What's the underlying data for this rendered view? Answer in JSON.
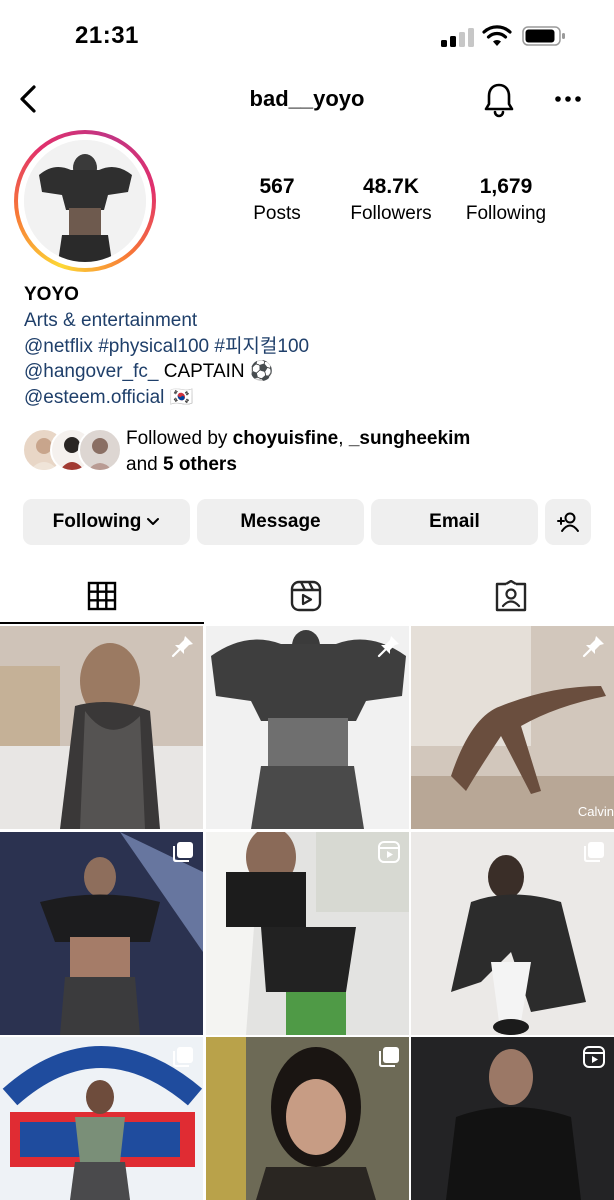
{
  "status_bar": {
    "time": "21:31"
  },
  "header": {
    "username": "bad__yoyo"
  },
  "stats": [
    {
      "num": "567",
      "label": "Posts"
    },
    {
      "num": "48.7K",
      "label": "Followers"
    },
    {
      "num": "1,679",
      "label": "Following"
    }
  ],
  "bio": {
    "name": "YOYO",
    "category": "Arts & entertainment",
    "line1": "@netflix #physical100 #피지컬100",
    "line2_link": "@hangover_fc_",
    "line2_text": " CAPTAIN ⚽",
    "line3_link": "@esteem.official",
    "line3_flag": " 🇰🇷"
  },
  "followed_by": {
    "prefix": "Followed by ",
    "user1": "choyuisfine",
    "sep": ", ",
    "user2": "_sungheekim",
    "and": "and ",
    "others": "5 others"
  },
  "buttons": {
    "following": "Following",
    "message": "Message",
    "email": "Email"
  },
  "tabs": [
    "grid",
    "reels",
    "tagged"
  ],
  "grid_posts": [
    {
      "badge": "pin",
      "bg": "#bfb1a6"
    },
    {
      "badge": "pin",
      "bg": "#e9e9e9"
    },
    {
      "badge": "pin",
      "bg": "#cbbfb4",
      "caption": "Calvin"
    },
    {
      "badge": "carousel",
      "bg": "#2d3550"
    },
    {
      "badge": "reel",
      "bg": "#d7d8d6"
    },
    {
      "badge": "carousel",
      "bg": "#e6e4e2"
    },
    {
      "badge": "carousel",
      "bg": "#a7c0d8"
    },
    {
      "badge": "carousel",
      "bg": "#5a5a52"
    },
    {
      "badge": "reel",
      "bg": "#2b2b2d"
    }
  ],
  "colors": {
    "link": "#1f3f6a",
    "button_bg": "#efefef",
    "ring_pink": "#e1306c",
    "ring_yellow": "#fdd835"
  }
}
